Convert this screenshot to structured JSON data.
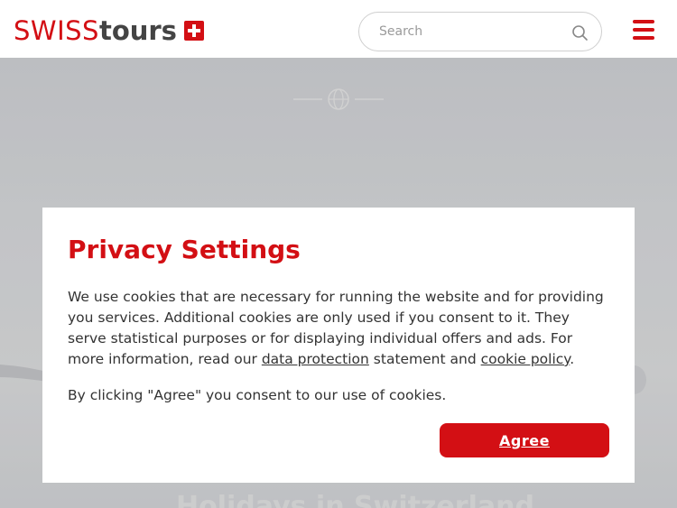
{
  "header": {
    "logo": {
      "swiss": "SWISS",
      "tours": "tours"
    },
    "search": {
      "placeholder": "Search",
      "value": "",
      "icon": "search-icon"
    },
    "menu_icon": "hamburger-menu-icon"
  },
  "hero": {
    "globe_icon": "globe-icon",
    "title": "Holidays in Switzerland"
  },
  "privacy_modal": {
    "title": "Privacy Settings",
    "body_before_link1": "We use cookies that are necessary for running the website and for providing you services. Additional cookies are only used if you consent to it. They serve statistical purposes or for displaying individual offers and ads. For more information, read our ",
    "link_data_protection": "data protection",
    "body_between_links": " statement and ",
    "link_cookie_policy": "cookie policy",
    "body_after_link2": ".",
    "consent_text": "By clicking \"Agree\" you consent to our use of cookies.",
    "agree_button": "Agree"
  },
  "colors": {
    "brand_red": "#d30f14",
    "text_dark": "#333333",
    "logo_grey": "#444444",
    "search_border": "#cfcfcf"
  }
}
